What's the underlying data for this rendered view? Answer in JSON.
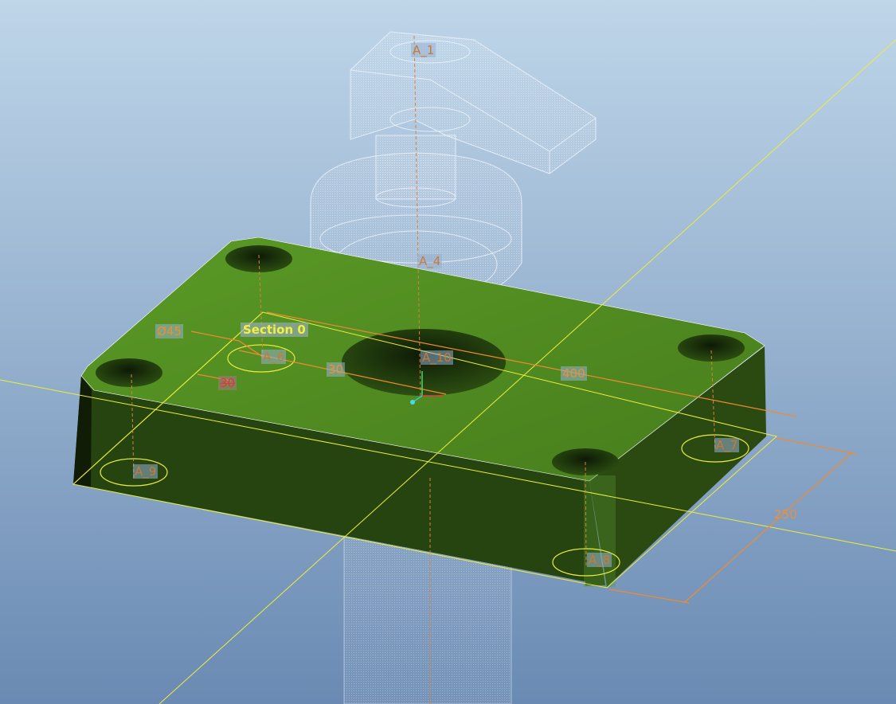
{
  "viewport": {
    "background_top": "#bcd3e6",
    "background_bottom": "#6e8db4",
    "part_color": "#4f8a22",
    "part_side_color": "#2a4a10",
    "sketch_color": "#f0f040",
    "dimension_color": "#f08a30",
    "ghost_color": "#e8eef6"
  },
  "datum_axes": [
    "A_1",
    "A_4",
    "A_6",
    "A_10",
    "A_7",
    "A_9",
    "A_8"
  ],
  "section_label": "Section 0",
  "dimensions": {
    "diameter": "Ø45",
    "offset_red": "30",
    "offset": "30",
    "length": "400",
    "width": "250"
  }
}
